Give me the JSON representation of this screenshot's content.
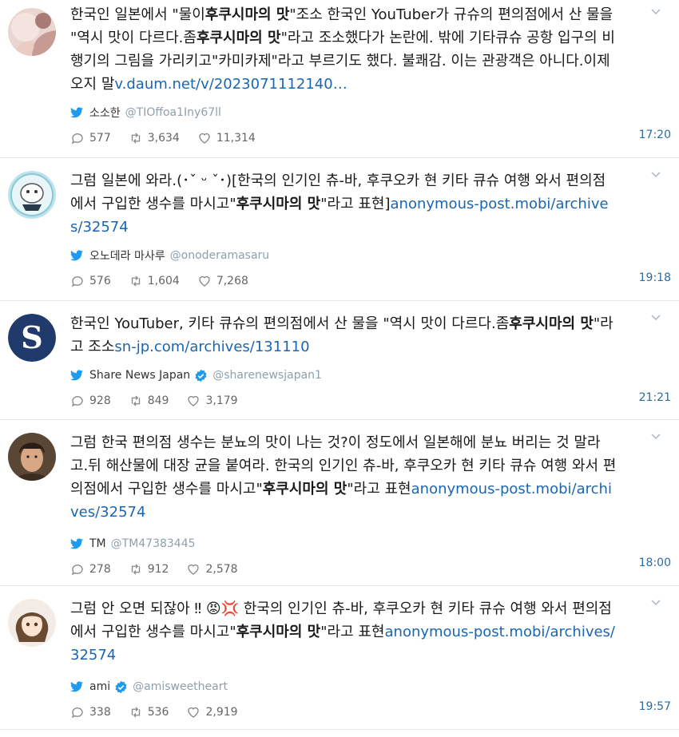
{
  "tweets": [
    {
      "text_parts": [
        {
          "t": "한국인 일본에서 \"물이"
        },
        {
          "t": "후쿠시마의 맛",
          "bold": true
        },
        {
          "t": "\"조소 한국인 YouTuber가 규슈의 편의점에서 산 물을 \"역시 맛이 다르다.좀"
        },
        {
          "t": "후쿠시마의 맛",
          "bold": true
        },
        {
          "t": "\"라고 조소했다가 논란에. 밖에 기타큐슈 공항 입구의 비행기의 그림을 가리키고\"카미카제\"라고 부르기도 했다. 불쾌감. 이는 관광객은 아니다.이제 오지 말"
        },
        {
          "t": "v.daum.net/v/2023071112140…",
          "link": true
        }
      ],
      "name": "소소한",
      "handle": "@TIOffoa1Iny67ll",
      "verified": false,
      "replies": "577",
      "retweets": "3,634",
      "likes": "11,314",
      "time": "17:20",
      "avatar": "avatar-woman-hand"
    },
    {
      "text_parts": [
        {
          "t": "그럼 일본에 와라.(･ˇ ᵕ ˇ･)[한국의 인기인 츄-바, 후쿠오카 현 키타 큐슈 여행 와서 편의점에서 구입한 생수를 마시고\""
        },
        {
          "t": "후쿠시마의 맛",
          "bold": true
        },
        {
          "t": "\"라고 표현]"
        },
        {
          "t": "anonymous-post.mobi/archives/32574",
          "link": true
        }
      ],
      "name": "오노데라 마사루",
      "handle": "@onoderamasaru",
      "verified": false,
      "replies": "576",
      "retweets": "1,604",
      "likes": "7,268",
      "time": "19:18",
      "avatar": "avatar-cartoon-cat"
    },
    {
      "text_parts": [
        {
          "t": "한국인 YouTuber, 키타 큐슈의 편의점에서 산 물을 \"역시 맛이 다르다.좀"
        },
        {
          "t": "후쿠시마의 맛",
          "bold": true
        },
        {
          "t": "\"라고 조소"
        },
        {
          "t": "sn-jp.com/archives/131110",
          "link": true
        }
      ],
      "name": "Share News Japan",
      "handle": "@sharenewsjapan1",
      "verified": true,
      "replies": "928",
      "retweets": "849",
      "likes": "3,179",
      "time": "21:21",
      "avatar": "avatar-s-logo"
    },
    {
      "text_parts": [
        {
          "t": "그럼 한국 편의점 생수는 분뇨의 맛이 나는 것?이 정도에서 일본해에 분뇨 버리는 것 말라고.뒤 해산물에 대장 균을 붙여라. 한국의 인기인 츄-바, 후쿠오카 현 키타 큐슈 여행 와서 편의점에서 구입한 생수를 마시고\""
        },
        {
          "t": "후쿠시마의 맛",
          "bold": true
        },
        {
          "t": "\"라고 표현"
        },
        {
          "t": "anonymous-post.mobi/archives/32574",
          "link": true
        }
      ],
      "name": "TM",
      "handle": "@TM47383445",
      "verified": false,
      "replies": "278",
      "retweets": "912",
      "likes": "2,578",
      "time": "18:00",
      "avatar": "avatar-warrior"
    },
    {
      "text_parts": [
        {
          "t": "그럼 안 오면 되잖아 ‼ 😡💢 한국의 인기인 츄-바, 후쿠오카 현 키타 큐슈 여행 와서 편의점에서 구입한 생수를 마시고\""
        },
        {
          "t": "후쿠시마의 맛",
          "bold": true
        },
        {
          "t": "\"라고 표현"
        },
        {
          "t": "anonymous-post.mobi/archives/32574",
          "link": true
        }
      ],
      "name": "ami",
      "handle": "@amisweetheart",
      "verified": true,
      "replies": "338",
      "retweets": "536",
      "likes": "2,919",
      "time": "19:57",
      "avatar": "avatar-anime-girl"
    }
  ],
  "colors": {
    "link": "#1b66b0",
    "twitter_blue": "#1d9bf0",
    "handle": "#8ea0ad",
    "time": "#2b6ca3"
  }
}
